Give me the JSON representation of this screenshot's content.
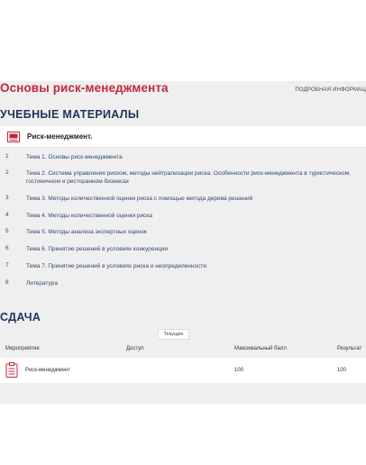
{
  "course": {
    "title": "Основы риск-менеджмента",
    "more_info": "ПОДРОБНАЯ ИНФОРМАЦ"
  },
  "materials": {
    "heading": "УЧЕБНЫЕ МАТЕРИАЛЫ",
    "block_title": "Риск-менеджмент.",
    "block_icon": "book-icon",
    "items": [
      {
        "num": "1",
        "title": "Тема 1. Основы риск-менеджмента"
      },
      {
        "num": "2",
        "title": "Тема 2. Система управления риском, методы нейтрализации риска. Особенности риск-менеджмента в туристическом, гостиничном и ресторанном бизнесах"
      },
      {
        "num": "3",
        "title": "Тема 3. Методы количественной оценки риска с помощью метода дерева решений"
      },
      {
        "num": "4",
        "title": "Тема 4. Методы количественной оценки риска"
      },
      {
        "num": "5",
        "title": "Тема 5. Методы анализа экспертных оценок"
      },
      {
        "num": "6",
        "title": "Тема 6. Принятие решений в условиях конкуренции"
      },
      {
        "num": "7",
        "title": "Тема 7. Принятие решений в условиях риска и неопределенности"
      },
      {
        "num": "8",
        "title": "Литература"
      }
    ]
  },
  "sdacha": {
    "heading": "СДАЧА",
    "tab_label": "Текущие",
    "columns": {
      "event": "Мероприятие",
      "access": "Доступ",
      "max_score": "Максимальный балл",
      "result": "Результат"
    },
    "rows": [
      {
        "icon": "test-icon",
        "event": "Риск-менеджмент",
        "access": "",
        "max_score": "100",
        "result": "100"
      }
    ]
  },
  "colors": {
    "course_title": "#c0283c",
    "section_heading": "#1f3358",
    "topic_link": "#2f4a6e",
    "icon_accent": "#c0283c",
    "band_background": "#efefef"
  }
}
